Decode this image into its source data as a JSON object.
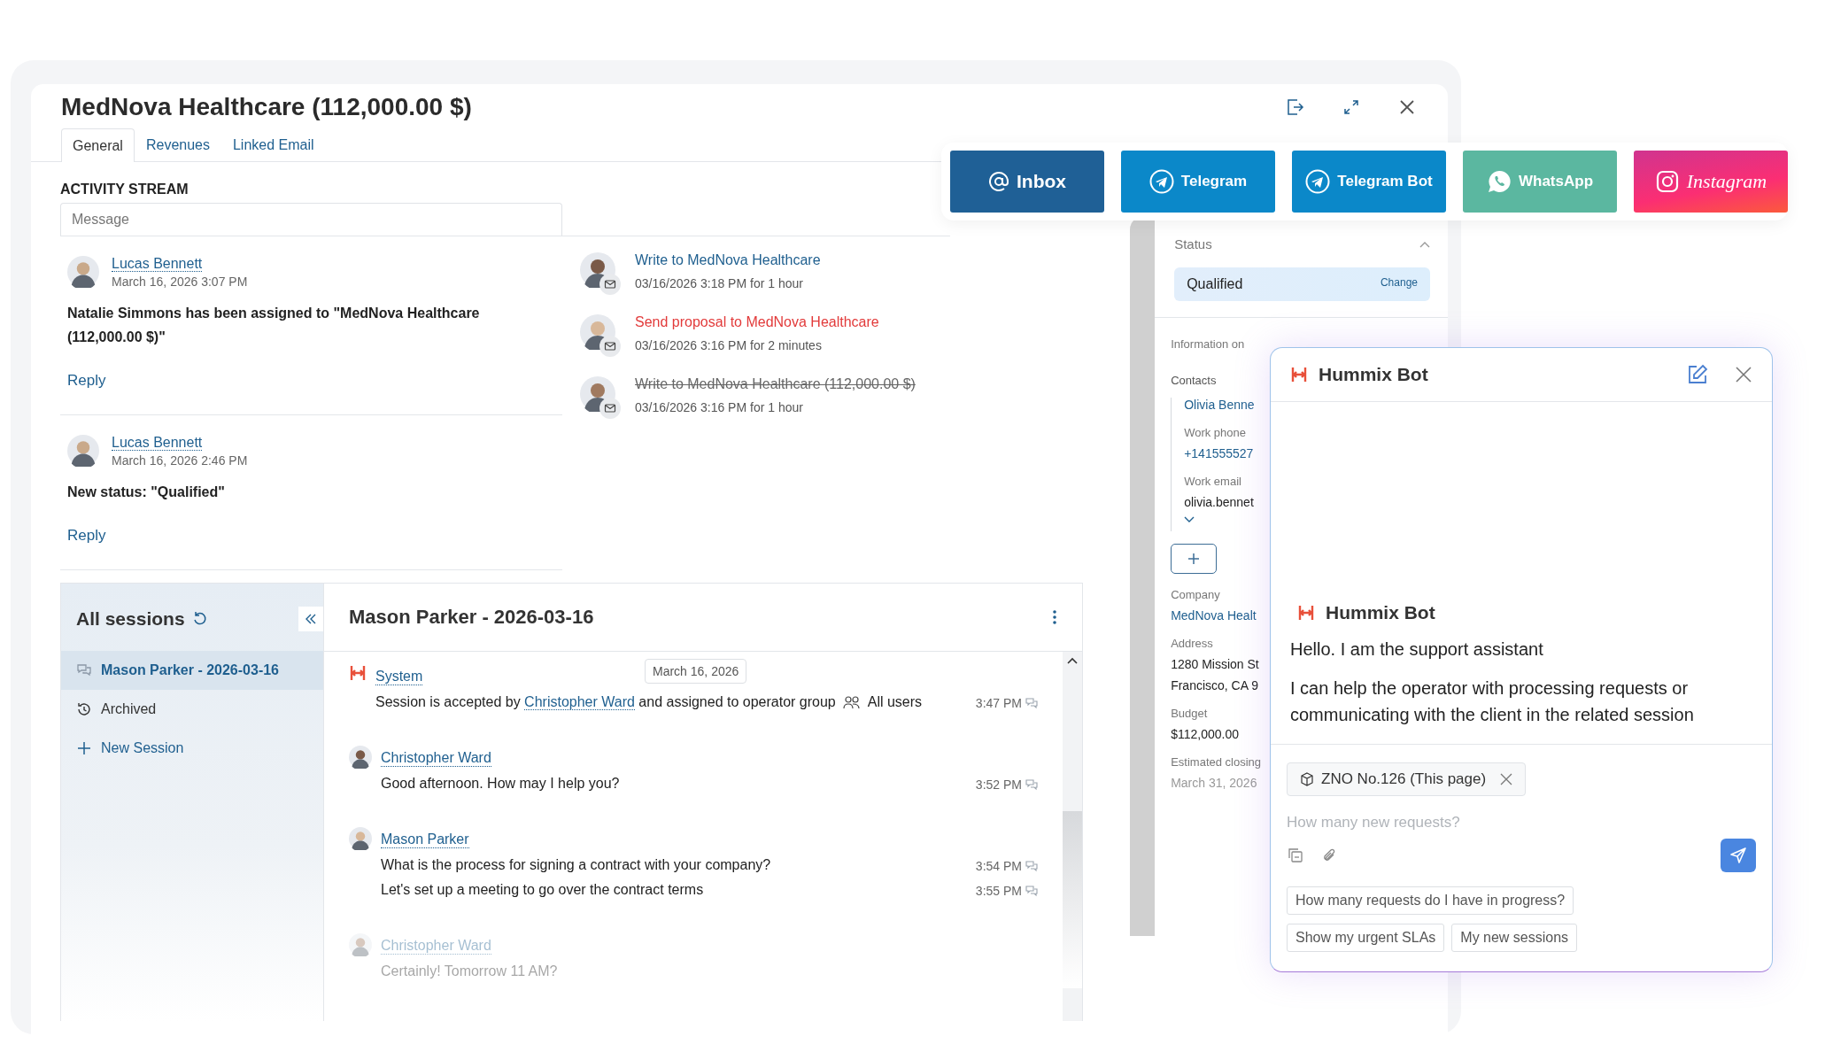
{
  "window": {
    "title": "MedNova Healthcare (112,000.00 $)",
    "tabs": [
      {
        "label": "General",
        "selected": true
      },
      {
        "label": "Revenues",
        "selected": false
      },
      {
        "label": "Linked Email",
        "selected": false
      }
    ]
  },
  "activity_stream": {
    "heading": "ACTIVITY STREAM",
    "placeholder": "Message",
    "posts": [
      {
        "author": "Lucas Bennett",
        "time": "March 16, 2026 3:07 PM",
        "text": "Natalie Simmons has been assigned to \"MedNova Healthcare (112,000.00 $)\"",
        "reply": "Reply"
      },
      {
        "author": "Lucas Bennett",
        "time": "March 16, 2026 2:46 PM",
        "text": "New status: \"Qualified\"",
        "reply": "Reply"
      }
    ],
    "tasks": [
      {
        "title": "Write to MedNova Healthcare",
        "when": "03/16/2026 3:18 PM for 1 hour",
        "kind": "open"
      },
      {
        "title": "Send proposal to MedNova Healthcare",
        "when": "03/16/2026 3:16 PM for 2 minutes",
        "kind": "overdue"
      },
      {
        "title": "Write to MedNova Healthcare (112,000.00 $)",
        "when": "03/16/2026 3:16 PM for 1 hour",
        "kind": "completed"
      }
    ]
  },
  "channels": [
    {
      "label": "Inbox",
      "kind": "inbox"
    },
    {
      "label": "Telegram",
      "kind": "telegram"
    },
    {
      "label": "Telegram Bot",
      "kind": "telegram"
    },
    {
      "label": "WhatsApp",
      "kind": "whatsapp"
    },
    {
      "label": "Instagram",
      "kind": "instagram"
    }
  ],
  "details": {
    "status_label": "Status",
    "status": "Qualified",
    "change": "Change",
    "info_heading": "Information on",
    "contacts_label": "Contacts",
    "contact": "Olivia Benne",
    "contact_fields": [
      {
        "label": "Work phone",
        "value": "+141555527",
        "kind": "link"
      },
      {
        "label": "Work email",
        "value": "olivia.bennet",
        "kind": "text"
      }
    ],
    "facts": [
      {
        "label": "Company",
        "lines": [
          "MedNova Healt"
        ],
        "kind": "link"
      },
      {
        "label": "Address",
        "lines": [
          "1280 Mission St",
          "Francisco, CA 9"
        ],
        "kind": "text"
      },
      {
        "label": "Budget",
        "lines": [
          "$112,000.00"
        ],
        "kind": "text"
      },
      {
        "label": "Estimated closing",
        "lines": [
          "March 31, 2026"
        ],
        "kind": "muted"
      }
    ]
  },
  "sessions": {
    "title": "All sessions",
    "items": [
      {
        "label": "Mason Parker - 2026-03-16",
        "kind": "session",
        "selected": true
      },
      {
        "label": "Archived",
        "kind": "archive",
        "selected": false
      },
      {
        "label": "New Session",
        "kind": "new",
        "selected": false
      }
    ],
    "chat": {
      "title": "Mason Parker - 2026-03-16",
      "date": "March 16, 2026",
      "messages": [
        {
          "author": "System",
          "kind": "system",
          "faded": false,
          "lines": [
            {
              "kind": "event",
              "before": "Session is accepted by",
              "link": "Christopher Ward",
              "after": "and assigned to operator group",
              "group": "All users",
              "time": "3:47 PM"
            }
          ]
        },
        {
          "author": "Christopher Ward",
          "kind": "person",
          "faded": false,
          "lines": [
            {
              "kind": "text",
              "text": "Good afternoon. How may I help you?",
              "time": "3:52 PM"
            }
          ]
        },
        {
          "author": "Mason Parker",
          "kind": "person",
          "faded": false,
          "lines": [
            {
              "kind": "text",
              "text": "What is the process for signing a contract with your company?",
              "time": "3:54 PM"
            },
            {
              "kind": "text",
              "text": "Let's set up a meeting to go over the contract terms",
              "time": "3:55 PM"
            }
          ]
        },
        {
          "author": "Christopher Ward",
          "kind": "person",
          "faded": true,
          "lines": [
            {
              "kind": "text",
              "text": "Certainly! Tomorrow 11 AM?"
            }
          ]
        }
      ]
    }
  },
  "bot": {
    "title": "Hummix Bot",
    "sender": "Hummix Bot",
    "paragraphs": [
      "Hello. I am the support assistant",
      "I can help the operator with processing requests or communicating with the client in the related session"
    ],
    "context": "ZNO No.126 (This page)",
    "placeholder": "How many new requests?",
    "suggestions": [
      "How many requests do I have in progress?",
      "Show my urgent SLAs",
      "My new sessions"
    ]
  }
}
